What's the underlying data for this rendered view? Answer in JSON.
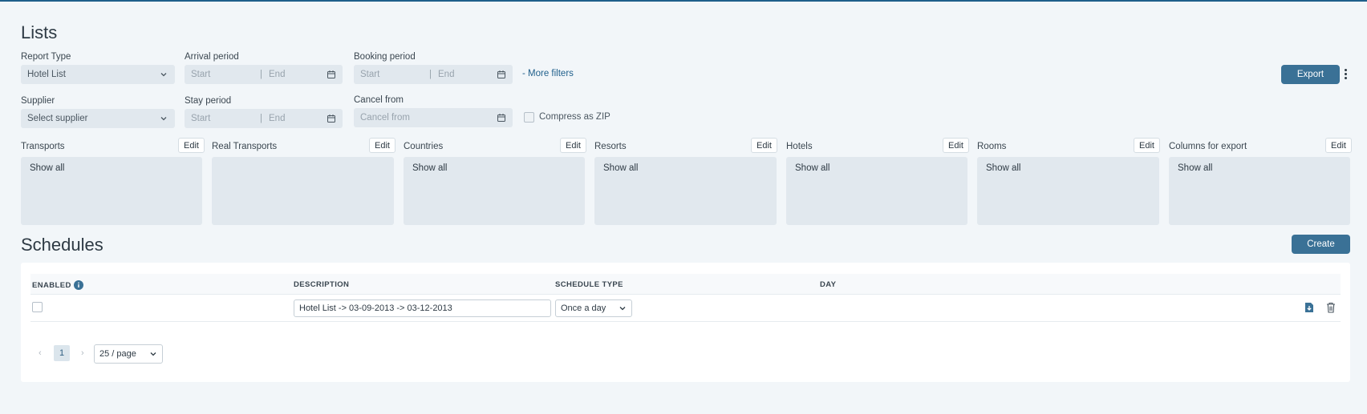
{
  "lists": {
    "title": "Lists",
    "report_type": {
      "label": "Report Type",
      "value": "Hotel List"
    },
    "arrival_period": {
      "label": "Arrival period",
      "start_placeholder": "Start",
      "end_placeholder": "End"
    },
    "booking_period": {
      "label": "Booking period",
      "start_placeholder": "Start",
      "end_placeholder": "End"
    },
    "more_filters": "- More filters",
    "export_label": "Export",
    "supplier": {
      "label": "Supplier",
      "value": "Select supplier"
    },
    "stay_period": {
      "label": "Stay period",
      "start_placeholder": "Start",
      "end_placeholder": "End"
    },
    "cancel_from": {
      "label": "Cancel from",
      "placeholder": "Cancel from"
    },
    "compress_zip": "Compress as ZIP",
    "edit_label": "Edit",
    "panels": [
      {
        "title": "Transports",
        "content": "Show all"
      },
      {
        "title": "Real Transports",
        "content": ""
      },
      {
        "title": "Countries",
        "content": "Show all"
      },
      {
        "title": "Resorts",
        "content": "Show all"
      },
      {
        "title": "Hotels",
        "content": "Show all"
      },
      {
        "title": "Rooms",
        "content": "Show all"
      },
      {
        "title": "Columns for export",
        "content": "Show all"
      }
    ]
  },
  "schedules": {
    "title": "Schedules",
    "create_label": "Create",
    "columns": [
      "ENABLED",
      "DESCRIPTION",
      "SCHEDULE TYPE",
      "DAY"
    ],
    "rows": [
      {
        "enabled": false,
        "description": "Hotel List -> 03-09-2013 -> 03-12-2013",
        "schedule_type": "Once a day",
        "day": ""
      }
    ],
    "pagination": {
      "prev": "‹",
      "current": "1",
      "next": "›",
      "page_size": "25 / page"
    }
  },
  "colors": {
    "primary": "#3a7196",
    "background": "#f2f6f9",
    "field": "#e1e8ee",
    "top_border": "#1f5f8b"
  }
}
